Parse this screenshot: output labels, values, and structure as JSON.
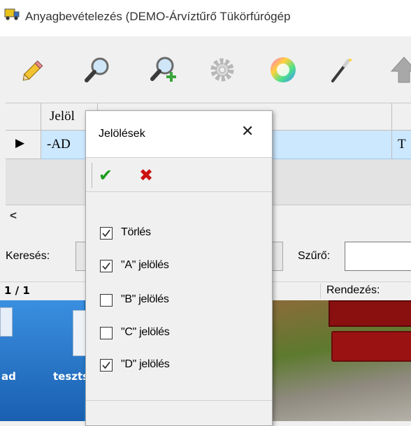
{
  "window": {
    "title": "Anyagbevételezés (DEMO-Árvíztűrő Tükörfúrógép"
  },
  "toolbar": {
    "buttons": [
      {
        "icon": "pencil-icon"
      },
      {
        "icon": "magnifier-icon"
      },
      {
        "icon": "magnifier-add-icon"
      },
      {
        "icon": "gear-icon"
      },
      {
        "icon": "color-wheel-icon"
      },
      {
        "icon": "magic-wand-icon"
      },
      {
        "icon": "arrow-up-icon"
      }
    ]
  },
  "grid": {
    "header": {
      "col1": "Jelöl"
    },
    "row": {
      "marker": "▶",
      "col1": "-AD",
      "col_right": "T"
    },
    "scroll_left": "<"
  },
  "search": {
    "label": "Keresés:",
    "filter_label": "Szűrő:"
  },
  "status": {
    "page": "1 / 1",
    "sort_label": "Rendezés:"
  },
  "desktop": {
    "icon_label_1": "ad",
    "icon_label_2": "teszts"
  },
  "popup": {
    "title": "Jelölések",
    "close": "✕",
    "accept_glyph": "✔",
    "cancel_glyph": "✖",
    "options": [
      {
        "label": "Törlés",
        "checked": true
      },
      {
        "label": "\"A\" jelölés",
        "checked": true
      },
      {
        "label": "\"B\" jelölés",
        "checked": false
      },
      {
        "label": "\"C\" jelölés",
        "checked": false
      },
      {
        "label": "\"D\" jelölés",
        "checked": true
      }
    ]
  },
  "colors": {
    "selection": "#cce8ff",
    "accept_green": "#1a9c1a",
    "cancel_red": "#cc1111",
    "desktop_blue": "#1d78c8"
  }
}
